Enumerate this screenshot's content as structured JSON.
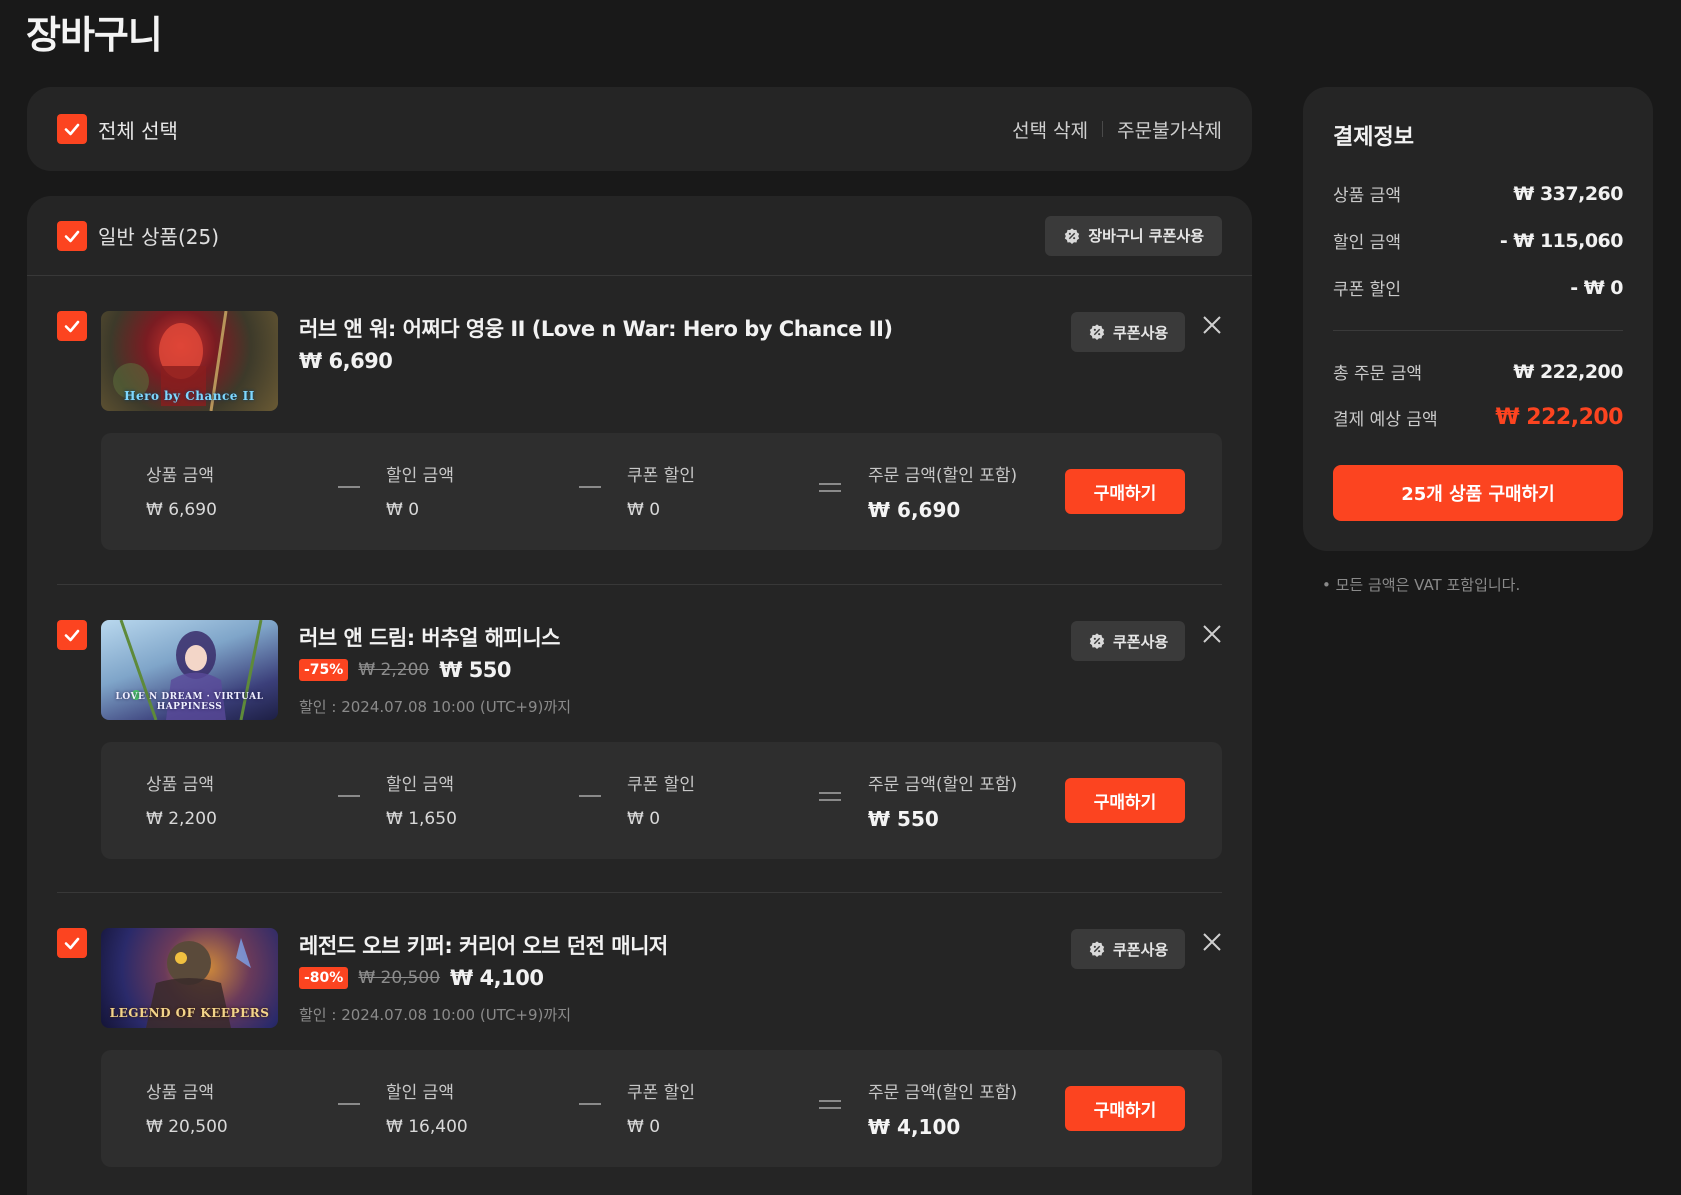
{
  "page": {
    "title": "장바구니"
  },
  "select_bar": {
    "select_all_label": "전체 선택",
    "delete_selected": "선택 삭제",
    "delete_unavailable": "주문불가삭제"
  },
  "group": {
    "label": "일반 상품(25)",
    "cart_coupon_label": "장바구니 쿠폰사용"
  },
  "labels": {
    "item_coupon": "쿠폰사용",
    "product_amount": "상품 금액",
    "discount_amount": "할인 금액",
    "coupon_discount": "쿠폰 할인",
    "order_amount": "주문 금액(할인 포함)",
    "buy": "구매하기"
  },
  "items": [
    {
      "title": "러브 앤 워: 어쩌다 영웅 II (Love n War: Hero by Chance II)",
      "price": "₩ 6,690",
      "thumb_text": "Hero by Chance II",
      "calc": {
        "product": "₩ 6,690",
        "discount": "₩ 0",
        "coupon": "₩ 0",
        "order": "₩ 6,690"
      }
    },
    {
      "title": "러브 앤 드림: 버추얼 해피니스",
      "discount_badge": "-75%",
      "original_price": "₩ 2,200",
      "price": "₩ 550",
      "sale_until": "할인 : 2024.07.08 10:00 (UTC+9)까지",
      "thumb_text": "LOVE N DREAM · VIRTUAL HAPPINESS",
      "calc": {
        "product": "₩ 2,200",
        "discount": "₩ 1,650",
        "coupon": "₩ 0",
        "order": "₩ 550"
      }
    },
    {
      "title": "레전드 오브 키퍼: 커리어 오브 던전 매니저",
      "discount_badge": "-80%",
      "original_price": "₩ 20,500",
      "price": "₩ 4,100",
      "sale_until": "할인 : 2024.07.08 10:00 (UTC+9)까지",
      "thumb_text": "LEGEND OF KEEPERS",
      "calc": {
        "product": "₩ 20,500",
        "discount": "₩ 16,400",
        "coupon": "₩ 0",
        "order": "₩ 4,100"
      }
    }
  ],
  "payment": {
    "title": "결제정보",
    "product_amount_label": "상품 금액",
    "product_amount": "₩ 337,260",
    "discount_label": "할인 금액",
    "discount": "- ₩ 115,060",
    "coupon_label": "쿠폰 할인",
    "coupon": "- ₩ 0",
    "total_label": "총 주문 금액",
    "total": "₩ 222,200",
    "expected_label": "결제 예상 금액",
    "expected": "₩ 222,200",
    "buy_all": "25개 상품 구매하기",
    "vat_note": "• 모든 금액은 VAT 포함입니다."
  },
  "colors": {
    "accent": "#fc4420",
    "background": "#191919",
    "panel": "#252525"
  }
}
